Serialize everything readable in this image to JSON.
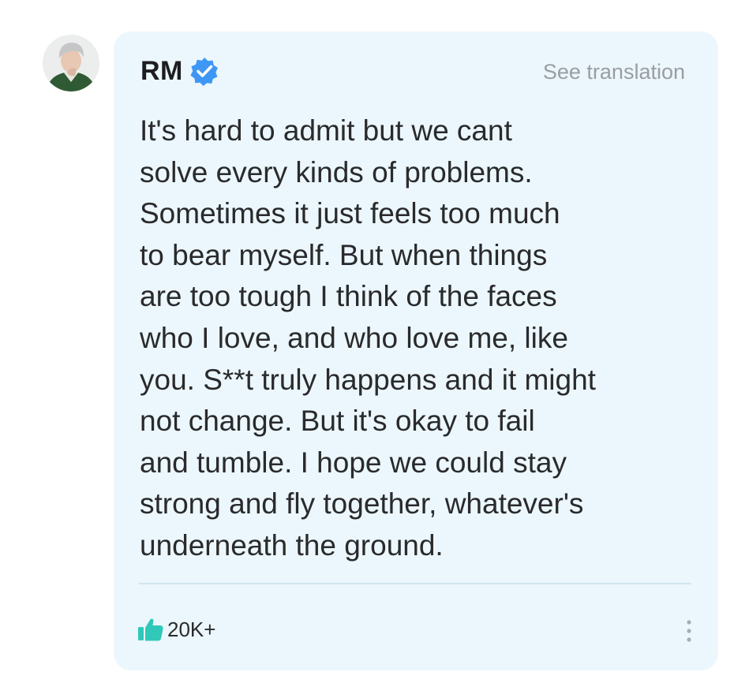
{
  "post": {
    "author": {
      "name": "RM",
      "avatar_icon": "profile-photo",
      "verified_icon": "verified-badge-icon",
      "verified_color": "#3e97f5"
    },
    "see_translation_label": "See translation",
    "body": "It's hard to admit but we cant\nsolve every kinds of problems.\nSometimes it just feels too much\nto bear myself. But when things\nare too tough I think of the faces\nwho I love, and who love me, like\nyou. S**t truly happens and it might\nnot change. But it's okay to fail\nand tumble. I hope we could stay\nstrong and fly together, whatever's\nunderneath the ground.",
    "likes": {
      "icon": "thumbs-up-icon",
      "icon_color": "#2fc8b9",
      "count": "20K+"
    },
    "more_icon": "more-vertical-icon",
    "card_background": "#ebf7fc"
  }
}
